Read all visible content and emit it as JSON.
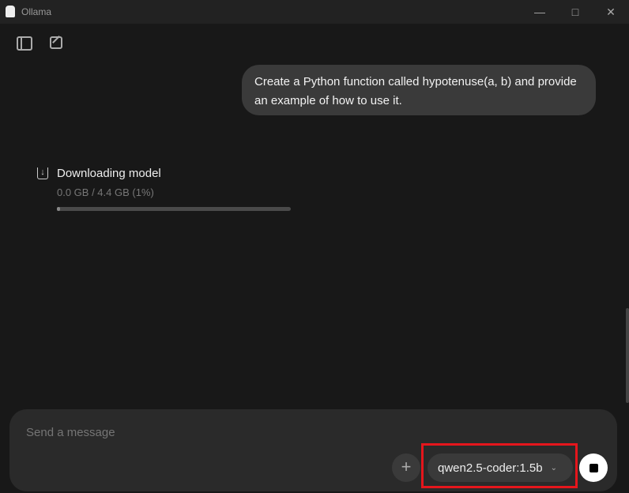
{
  "window": {
    "title": "Ollama",
    "controls": [
      "minimize",
      "maximize",
      "close"
    ]
  },
  "toolbar": {
    "icons": [
      "sidebar-toggle-icon",
      "new-chat-icon"
    ]
  },
  "messages": [
    {
      "role": "user",
      "text": "Create a Python function called hypotenuse(a, b) and provide an example of how to use it."
    }
  ],
  "download": {
    "title": "Downloading model",
    "status": "0.0 GB / 4.4 GB (1%)",
    "progress_percent": 1
  },
  "composer": {
    "placeholder": "Send a message",
    "model": "qwen2.5-coder:1.5b"
  },
  "colors": {
    "highlight": "#e5161c",
    "background": "#181818"
  }
}
